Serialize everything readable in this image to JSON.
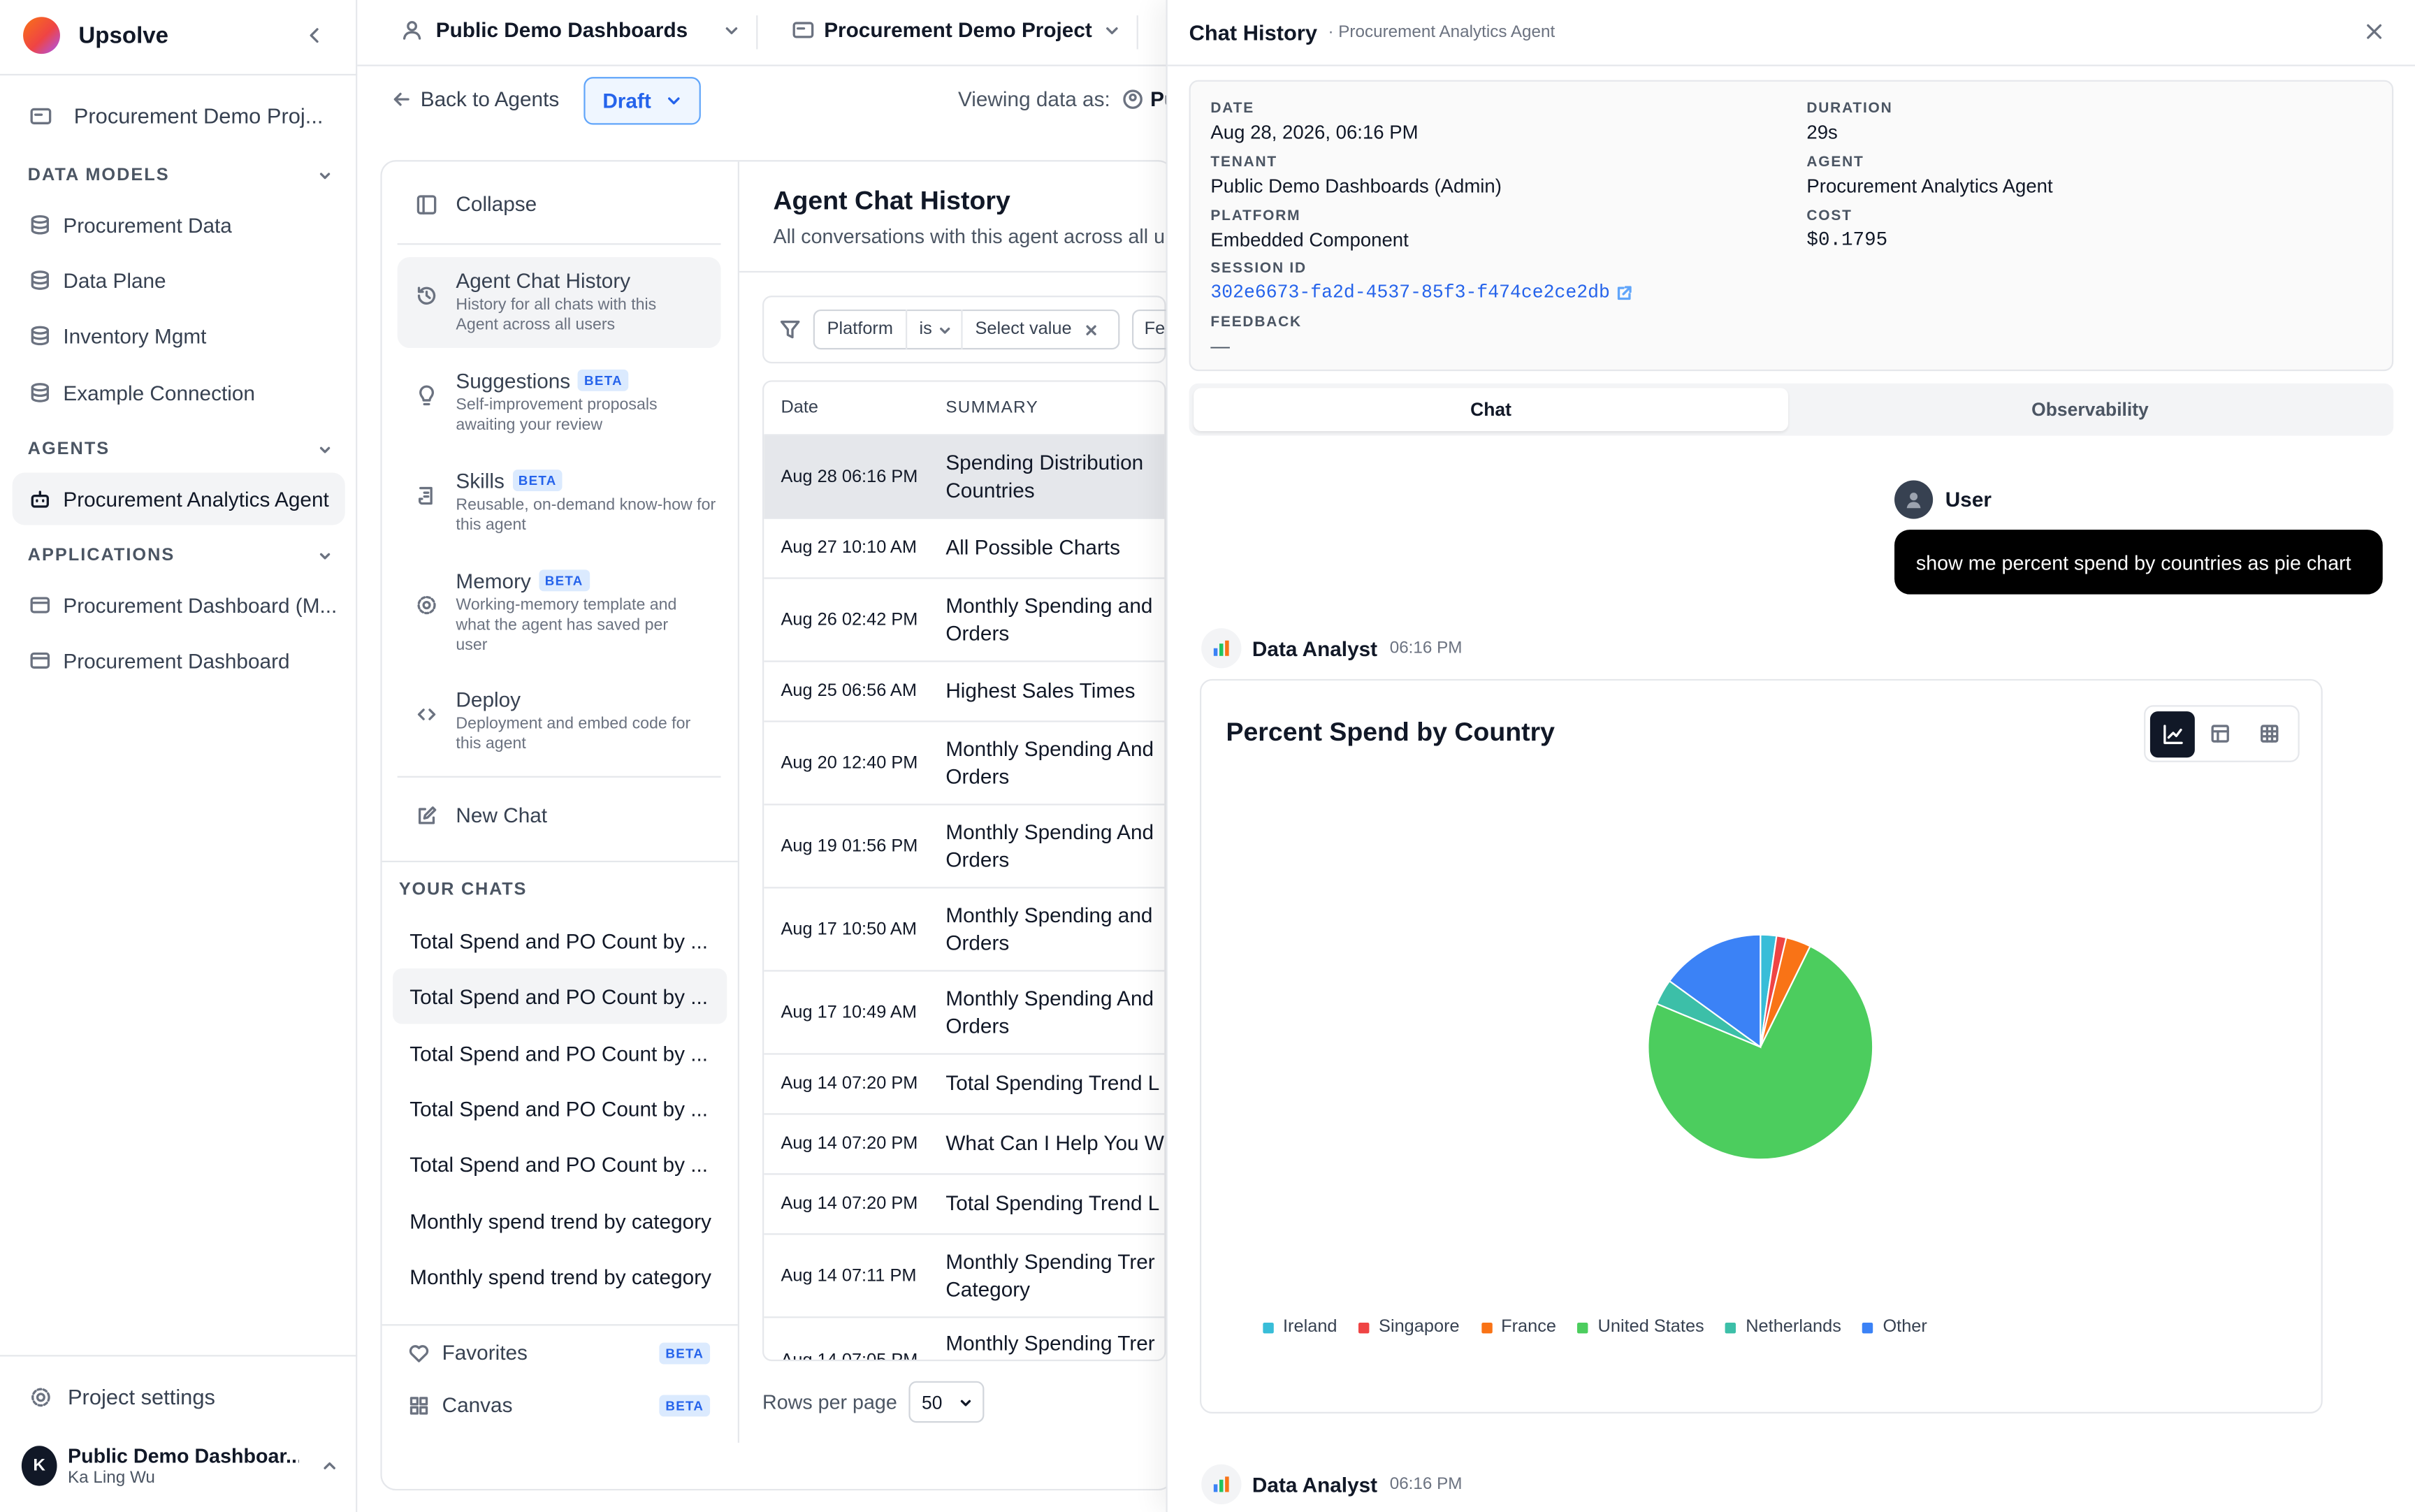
{
  "app": {
    "name": "Upsolve"
  },
  "sidebar": {
    "project": "Procurement Demo Proj...",
    "sections": [
      {
        "title": "DATA MODELS",
        "items": [
          "Procurement Data",
          "Data Plane",
          "Inventory Mgmt",
          "Example Connection"
        ]
      },
      {
        "title": "AGENTS",
        "items": [
          "Procurement Analytics Agent"
        ]
      },
      {
        "title": "APPLICATIONS",
        "items": [
          "Procurement Dashboard (M...",
          "Procurement Dashboard"
        ]
      }
    ],
    "settings": "Project settings",
    "user": {
      "initial": "K",
      "name": "Public Demo Dashboar...",
      "sub": "Ka Ling Wu"
    }
  },
  "topbar": {
    "org": "Public Demo Dashboards",
    "project": "Procurement Demo Project",
    "back": "Back to Agents",
    "status": "Draft",
    "viewing_label": "Viewing data as:",
    "viewing_value": "Pu"
  },
  "agent_nav": {
    "collapse": "Collapse",
    "items": [
      {
        "title": "Agent Chat History",
        "desc": "History for all chats with this Agent across all users",
        "beta": ""
      },
      {
        "title": "Suggestions",
        "desc": "Self-improvement proposals awaiting your review",
        "beta": "BETA"
      },
      {
        "title": "Skills",
        "desc": "Reusable, on-demand know-how for this agent",
        "beta": "BETA"
      },
      {
        "title": "Memory",
        "desc": "Working-memory template and what the agent has saved per user",
        "beta": "BETA"
      },
      {
        "title": "Deploy",
        "desc": "Deployment and embed code for this agent",
        "beta": ""
      }
    ],
    "new_chat": "New Chat",
    "your_chats_title": "YOUR CHATS",
    "chats": [
      "Total Spend and PO Count by ...",
      "Total Spend and PO Count by ...",
      "Total Spend and PO Count by ...",
      "Total Spend and PO Count by ...",
      "Total Spend and PO Count by ...",
      "Monthly spend trend by category",
      "Monthly spend trend by category"
    ],
    "favorites": "Favorites",
    "canvas": "Canvas",
    "beta": "BETA"
  },
  "history": {
    "title": "Agent Chat History",
    "subtitle": "All conversations with this agent across all u",
    "filter": {
      "field": "Platform",
      "op": "is",
      "value": "Select value",
      "next": "Fe"
    },
    "columns": [
      "Date",
      "SUMMARY"
    ],
    "rows": [
      {
        "date": "Aug 28 06:16 PM",
        "summary": "Spending Distribution Countries"
      },
      {
        "date": "Aug 27 10:10 AM",
        "summary": "All Possible Charts"
      },
      {
        "date": "Aug 26 02:42 PM",
        "summary": "Monthly Spending and Orders"
      },
      {
        "date": "Aug 25 06:56 AM",
        "summary": "Highest Sales Times"
      },
      {
        "date": "Aug 20 12:40 PM",
        "summary": "Monthly Spending And Orders"
      },
      {
        "date": "Aug 19 01:56 PM",
        "summary": "Monthly Spending And Orders"
      },
      {
        "date": "Aug 17 10:50 AM",
        "summary": "Monthly Spending and Orders"
      },
      {
        "date": "Aug 17 10:49 AM",
        "summary": "Monthly Spending And Orders"
      },
      {
        "date": "Aug 14 07:20 PM",
        "summary": "Total Spending Trend L"
      },
      {
        "date": "Aug 14 07:20 PM",
        "summary": "What Can I Help You W"
      },
      {
        "date": "Aug 14 07:20 PM",
        "summary": "Total Spending Trend L"
      },
      {
        "date": "Aug 14 07:11 PM",
        "summary": "Monthly Spending Trer Category"
      },
      {
        "date": "Aug 14 07:05 PM",
        "summary": "Monthly Spending Trer"
      }
    ],
    "rows_per_page_label": "Rows per page",
    "rows_per_page": "50"
  },
  "panel": {
    "title": "Chat History",
    "subtitle": "· Procurement Analytics Agent",
    "meta": {
      "date_label": "DATE",
      "date": "Aug 28, 2026, 06:16 PM",
      "duration_label": "DURATION",
      "duration": "29s",
      "tenant_label": "TENANT",
      "tenant": "Public Demo Dashboards (Admin)",
      "agent_label": "AGENT",
      "agent": "Procurement Analytics Agent",
      "platform_label": "PLATFORM",
      "platform": "Embedded Component",
      "cost_label": "COST",
      "cost": "$0.1795",
      "session_label": "SESSION ID",
      "session": "302e6673-fa2d-4537-85f3-f474ce2ce2db",
      "feedback_label": "FEEDBACK",
      "feedback": "—"
    },
    "tabs": [
      "Chat",
      "Observability"
    ],
    "user_label": "User",
    "user_message": "show me percent spend by countries as pie chart",
    "assistant_name": "Data Analyst",
    "assistant_time": "06:16 PM",
    "assistant_name_2": "Data Analyst",
    "assistant_time_2": "06:16 PM"
  },
  "chart_data": {
    "type": "pie",
    "title": "Percent Spend by Country",
    "labels": [
      "Ireland",
      "Singapore",
      "France",
      "United States",
      "Netherlands",
      "Other"
    ],
    "values": [
      2.3,
      1.4,
      3.6,
      74.0,
      3.7,
      15.0
    ],
    "colors": [
      "#38bdd8",
      "#ef4444",
      "#f97316",
      "#4ccd5e",
      "#3cbfa8",
      "#3b82f6"
    ],
    "legend_position": "bottom"
  }
}
